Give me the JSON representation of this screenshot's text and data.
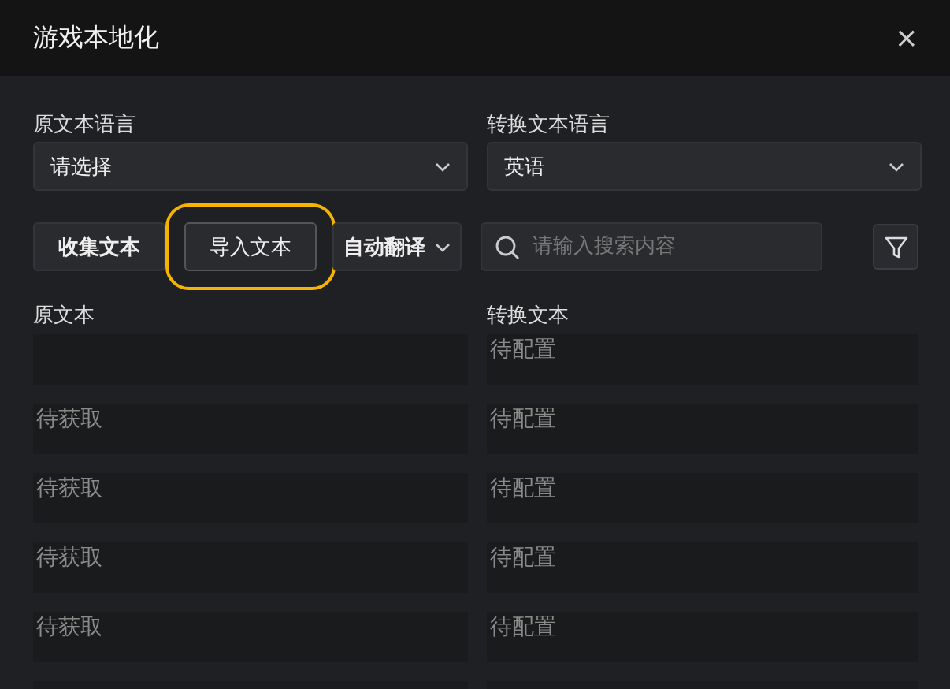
{
  "window": {
    "title": "游戏本地化",
    "close": "×"
  },
  "languages": [
    {
      "label": "原文本语言",
      "value": "请选择"
    },
    {
      "label": "转换文本语言",
      "value": "英语"
    }
  ],
  "actions": [
    {
      "label": "收集文本",
      "kind": "button",
      "highlighted": false
    },
    {
      "label": "导入文本",
      "kind": "button",
      "highlighted": true
    },
    {
      "label": "自动翻译",
      "kind": "dropdown",
      "highlighted": false
    }
  ],
  "search": {
    "placeholder": "请输入搜索内容"
  },
  "columns": [
    "原文本",
    "转换文本"
  ],
  "rows": [
    {
      "target": "待配置"
    },
    {
      "source": "待获取",
      "target": "待配置"
    },
    {
      "source": "待获取",
      "target": "待配置"
    },
    {
      "source": "待获取",
      "target": "待配置"
    },
    {
      "source": "待获取",
      "target": "待配置"
    }
  ]
}
